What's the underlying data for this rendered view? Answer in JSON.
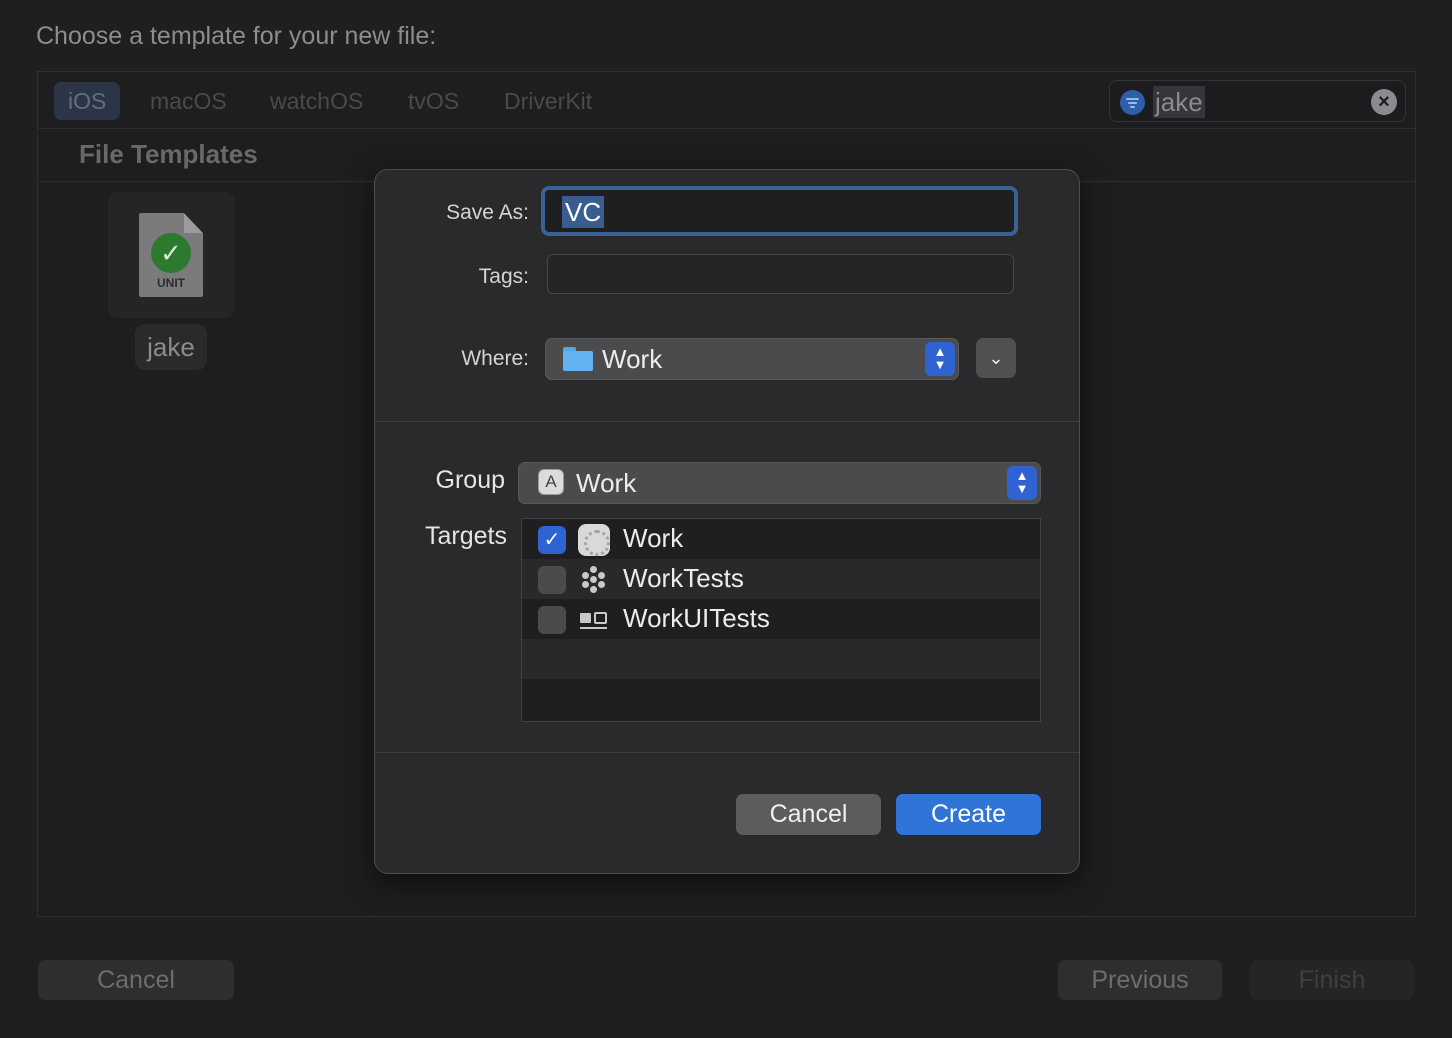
{
  "window": {
    "title": "Choose a template for your new file:"
  },
  "platform_tabs": [
    {
      "label": "iOS",
      "selected": true
    },
    {
      "label": "macOS",
      "selected": false
    },
    {
      "label": "watchOS",
      "selected": false
    },
    {
      "label": "tvOS",
      "selected": false
    },
    {
      "label": "DriverKit",
      "selected": false
    }
  ],
  "search": {
    "value": "jake"
  },
  "templates": {
    "section_title": "File Templates",
    "items": [
      {
        "name": "jake",
        "icon": "unit-test-file-icon",
        "badge": "UNIT"
      }
    ]
  },
  "footer": {
    "cancel_label": "Cancel",
    "previous_label": "Previous",
    "finish_label": "Finish"
  },
  "save_sheet": {
    "save_as_label": "Save As:",
    "save_as_value": "VC",
    "tags_label": "Tags:",
    "tags_value": "",
    "where_label": "Where:",
    "where_value": "Work",
    "group_label": "Group",
    "group_value": "Work",
    "targets_label": "Targets",
    "targets": [
      {
        "name": "Work",
        "checked": true,
        "icon": "app-target-icon"
      },
      {
        "name": "WorkTests",
        "checked": false,
        "icon": "unit-test-bundle-icon"
      },
      {
        "name": "WorkUITests",
        "checked": false,
        "icon": "ui-test-bundle-icon"
      }
    ],
    "cancel_label": "Cancel",
    "create_label": "Create"
  },
  "colors": {
    "accent": "#2f74d6",
    "selection": "#395d8f",
    "focus_ring": "#3a6297",
    "sheet_bg": "#2a2a2c"
  }
}
